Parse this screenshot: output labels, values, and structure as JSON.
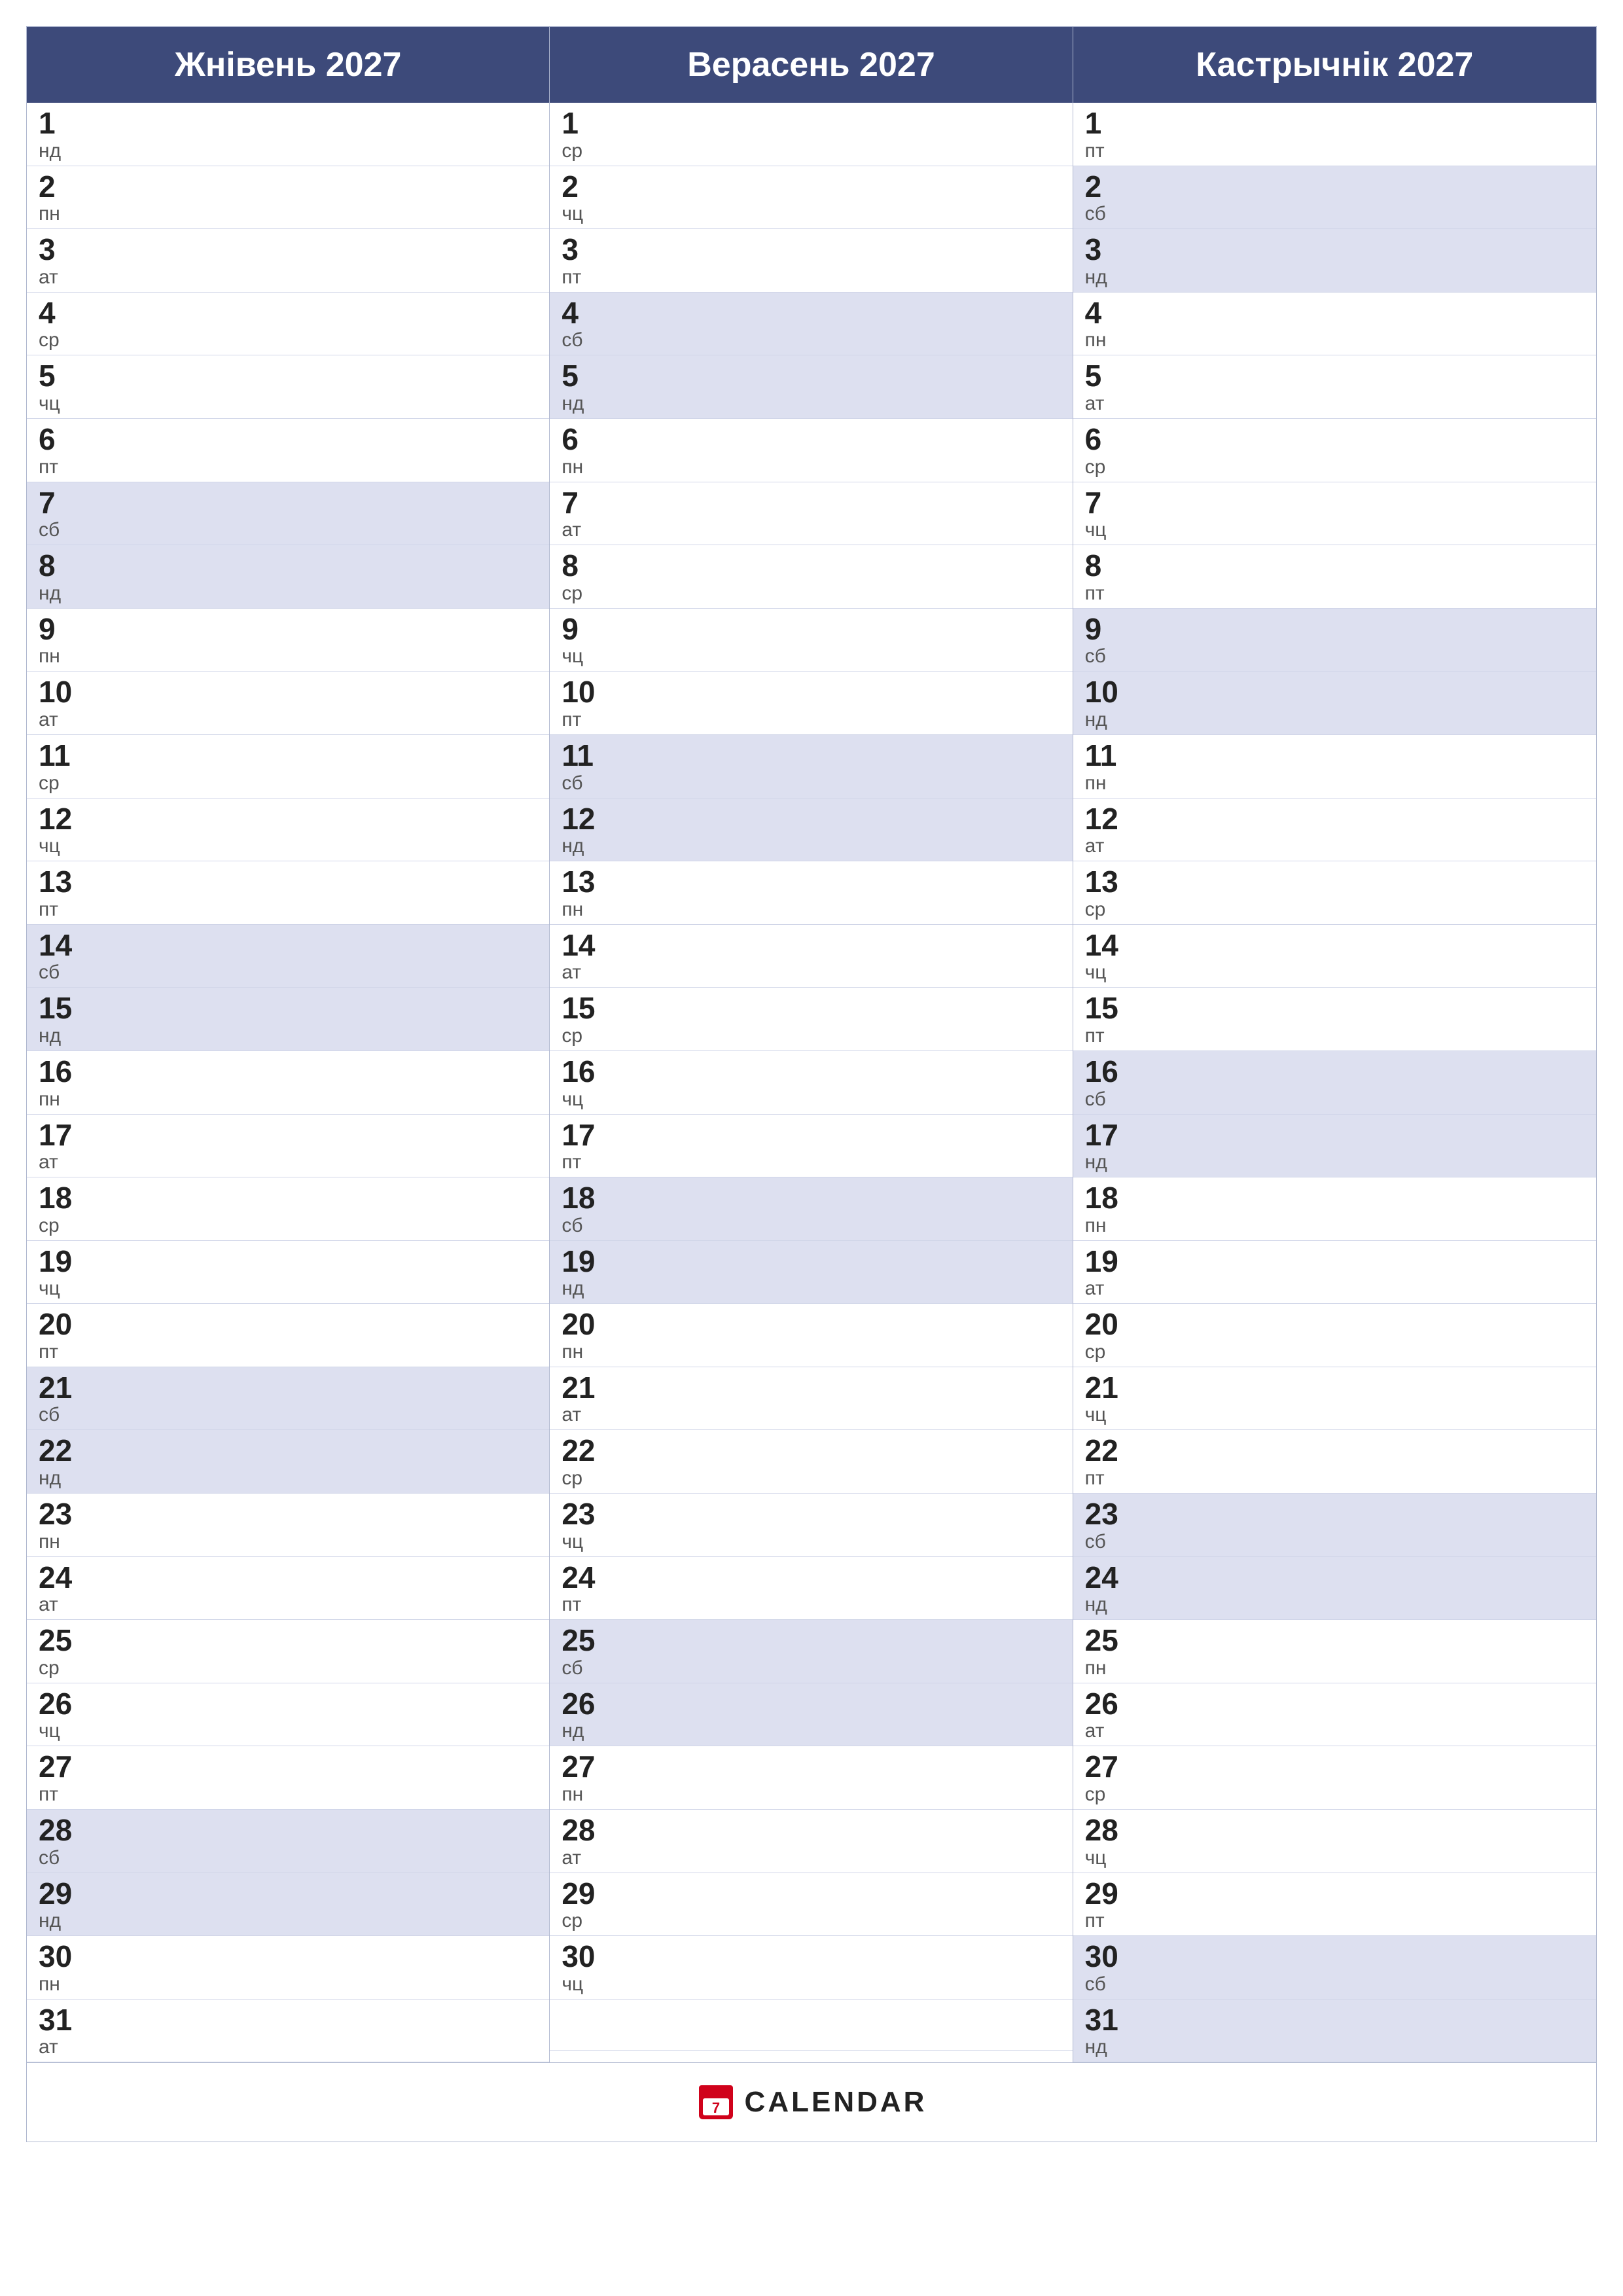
{
  "calendar": {
    "title": "CALENDAR",
    "months": [
      {
        "name": "Жнівень 2027",
        "id": "august",
        "days": [
          {
            "num": "1",
            "dayname": "нд",
            "highlight": false
          },
          {
            "num": "2",
            "dayname": "пн",
            "highlight": false
          },
          {
            "num": "3",
            "dayname": "ат",
            "highlight": false
          },
          {
            "num": "4",
            "dayname": "ср",
            "highlight": false
          },
          {
            "num": "5",
            "dayname": "чц",
            "highlight": false
          },
          {
            "num": "6",
            "dayname": "пт",
            "highlight": false
          },
          {
            "num": "7",
            "dayname": "сб",
            "highlight": true
          },
          {
            "num": "8",
            "dayname": "нд",
            "highlight": true
          },
          {
            "num": "9",
            "dayname": "пн",
            "highlight": false
          },
          {
            "num": "10",
            "dayname": "ат",
            "highlight": false
          },
          {
            "num": "11",
            "dayname": "ср",
            "highlight": false
          },
          {
            "num": "12",
            "dayname": "чц",
            "highlight": false
          },
          {
            "num": "13",
            "dayname": "пт",
            "highlight": false
          },
          {
            "num": "14",
            "dayname": "сб",
            "highlight": true
          },
          {
            "num": "15",
            "dayname": "нд",
            "highlight": true
          },
          {
            "num": "16",
            "dayname": "пн",
            "highlight": false
          },
          {
            "num": "17",
            "dayname": "ат",
            "highlight": false
          },
          {
            "num": "18",
            "dayname": "ср",
            "highlight": false
          },
          {
            "num": "19",
            "dayname": "чц",
            "highlight": false
          },
          {
            "num": "20",
            "dayname": "пт",
            "highlight": false
          },
          {
            "num": "21",
            "dayname": "сб",
            "highlight": true
          },
          {
            "num": "22",
            "dayname": "нд",
            "highlight": true
          },
          {
            "num": "23",
            "dayname": "пн",
            "highlight": false
          },
          {
            "num": "24",
            "dayname": "ат",
            "highlight": false
          },
          {
            "num": "25",
            "dayname": "ср",
            "highlight": false
          },
          {
            "num": "26",
            "dayname": "чц",
            "highlight": false
          },
          {
            "num": "27",
            "dayname": "пт",
            "highlight": false
          },
          {
            "num": "28",
            "dayname": "сб",
            "highlight": true
          },
          {
            "num": "29",
            "dayname": "нд",
            "highlight": true
          },
          {
            "num": "30",
            "dayname": "пн",
            "highlight": false
          },
          {
            "num": "31",
            "dayname": "ат",
            "highlight": false
          }
        ]
      },
      {
        "name": "Верасень 2027",
        "id": "september",
        "days": [
          {
            "num": "1",
            "dayname": "ср",
            "highlight": false
          },
          {
            "num": "2",
            "dayname": "чц",
            "highlight": false
          },
          {
            "num": "3",
            "dayname": "пт",
            "highlight": false
          },
          {
            "num": "4",
            "dayname": "сб",
            "highlight": true
          },
          {
            "num": "5",
            "dayname": "нд",
            "highlight": true
          },
          {
            "num": "6",
            "dayname": "пн",
            "highlight": false
          },
          {
            "num": "7",
            "dayname": "ат",
            "highlight": false
          },
          {
            "num": "8",
            "dayname": "ср",
            "highlight": false
          },
          {
            "num": "9",
            "dayname": "чц",
            "highlight": false
          },
          {
            "num": "10",
            "dayname": "пт",
            "highlight": false
          },
          {
            "num": "11",
            "dayname": "сб",
            "highlight": true
          },
          {
            "num": "12",
            "dayname": "нд",
            "highlight": true
          },
          {
            "num": "13",
            "dayname": "пн",
            "highlight": false
          },
          {
            "num": "14",
            "dayname": "ат",
            "highlight": false
          },
          {
            "num": "15",
            "dayname": "ср",
            "highlight": false
          },
          {
            "num": "16",
            "dayname": "чц",
            "highlight": false
          },
          {
            "num": "17",
            "dayname": "пт",
            "highlight": false
          },
          {
            "num": "18",
            "dayname": "сб",
            "highlight": true
          },
          {
            "num": "19",
            "dayname": "нд",
            "highlight": true
          },
          {
            "num": "20",
            "dayname": "пн",
            "highlight": false
          },
          {
            "num": "21",
            "dayname": "ат",
            "highlight": false
          },
          {
            "num": "22",
            "dayname": "ср",
            "highlight": false
          },
          {
            "num": "23",
            "dayname": "чц",
            "highlight": false
          },
          {
            "num": "24",
            "dayname": "пт",
            "highlight": false
          },
          {
            "num": "25",
            "dayname": "сб",
            "highlight": true
          },
          {
            "num": "26",
            "dayname": "нд",
            "highlight": true
          },
          {
            "num": "27",
            "dayname": "пн",
            "highlight": false
          },
          {
            "num": "28",
            "dayname": "ат",
            "highlight": false
          },
          {
            "num": "29",
            "dayname": "ср",
            "highlight": false
          },
          {
            "num": "30",
            "dayname": "чц",
            "highlight": false
          }
        ]
      },
      {
        "name": "Кастрычнік 2027",
        "id": "october",
        "days": [
          {
            "num": "1",
            "dayname": "пт",
            "highlight": false
          },
          {
            "num": "2",
            "dayname": "сб",
            "highlight": true
          },
          {
            "num": "3",
            "dayname": "нд",
            "highlight": true
          },
          {
            "num": "4",
            "dayname": "пн",
            "highlight": false
          },
          {
            "num": "5",
            "dayname": "ат",
            "highlight": false
          },
          {
            "num": "6",
            "dayname": "ср",
            "highlight": false
          },
          {
            "num": "7",
            "dayname": "чц",
            "highlight": false
          },
          {
            "num": "8",
            "dayname": "пт",
            "highlight": false
          },
          {
            "num": "9",
            "dayname": "сб",
            "highlight": true
          },
          {
            "num": "10",
            "dayname": "нд",
            "highlight": true
          },
          {
            "num": "11",
            "dayname": "пн",
            "highlight": false
          },
          {
            "num": "12",
            "dayname": "ат",
            "highlight": false
          },
          {
            "num": "13",
            "dayname": "ср",
            "highlight": false
          },
          {
            "num": "14",
            "dayname": "чц",
            "highlight": false
          },
          {
            "num": "15",
            "dayname": "пт",
            "highlight": false
          },
          {
            "num": "16",
            "dayname": "сб",
            "highlight": true
          },
          {
            "num": "17",
            "dayname": "нд",
            "highlight": true
          },
          {
            "num": "18",
            "dayname": "пн",
            "highlight": false
          },
          {
            "num": "19",
            "dayname": "ат",
            "highlight": false
          },
          {
            "num": "20",
            "dayname": "ср",
            "highlight": false
          },
          {
            "num": "21",
            "dayname": "чц",
            "highlight": false
          },
          {
            "num": "22",
            "dayname": "пт",
            "highlight": false
          },
          {
            "num": "23",
            "dayname": "сб",
            "highlight": true
          },
          {
            "num": "24",
            "dayname": "нд",
            "highlight": true
          },
          {
            "num": "25",
            "dayname": "пн",
            "highlight": false
          },
          {
            "num": "26",
            "dayname": "ат",
            "highlight": false
          },
          {
            "num": "27",
            "dayname": "ср",
            "highlight": false
          },
          {
            "num": "28",
            "dayname": "чц",
            "highlight": false
          },
          {
            "num": "29",
            "dayname": "пт",
            "highlight": false
          },
          {
            "num": "30",
            "dayname": "сб",
            "highlight": true
          },
          {
            "num": "31",
            "dayname": "нд",
            "highlight": true
          }
        ]
      }
    ]
  }
}
